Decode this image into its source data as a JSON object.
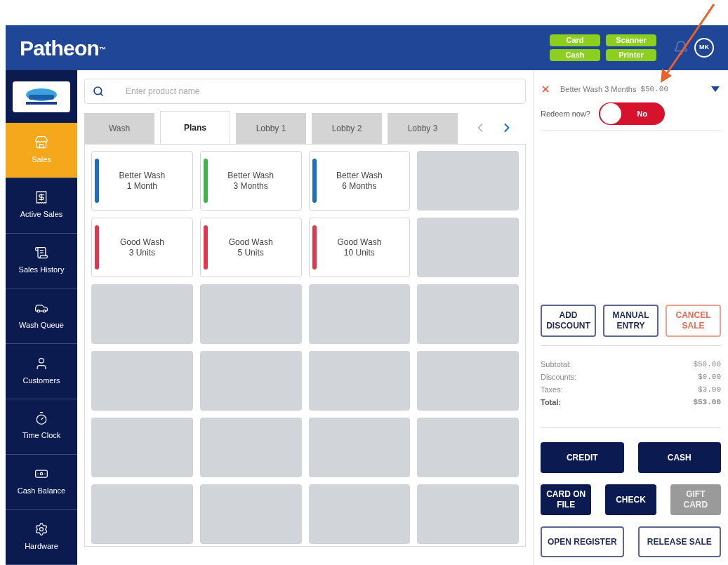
{
  "header": {
    "brand": "Patheon",
    "trademark": "™",
    "status_buttons": [
      "Card",
      "Scanner",
      "Cash",
      "Printer"
    ],
    "avatar": "MK"
  },
  "sidebar": {
    "items": [
      {
        "label": "Sales",
        "selected": true
      },
      {
        "label": "Active Sales",
        "selected": false
      },
      {
        "label": "Sales History",
        "selected": false
      },
      {
        "label": "Wash Queue",
        "selected": false
      },
      {
        "label": "Customers",
        "selected": false
      },
      {
        "label": "Time Clock",
        "selected": false
      },
      {
        "label": "Cash Balance",
        "selected": false
      },
      {
        "label": "Hardware",
        "selected": false
      }
    ]
  },
  "search": {
    "placeholder": "Enter product name"
  },
  "tabs": [
    {
      "label": "Wash",
      "selected": false
    },
    {
      "label": "Plans",
      "selected": true
    },
    {
      "label": "Lobby 1",
      "selected": false
    },
    {
      "label": "Lobby 2",
      "selected": false
    },
    {
      "label": "Lobby 3",
      "selected": false
    }
  ],
  "tiles": [
    {
      "kind": "product",
      "title": "Better Wash",
      "subtitle": "1 Month",
      "color": "#1a6fc0"
    },
    {
      "kind": "product",
      "title": "Better Wash",
      "subtitle": "3 Months",
      "color": "#3db54a"
    },
    {
      "kind": "product",
      "title": "Better Wash",
      "subtitle": "6 Months",
      "color": "#1a6fc0"
    },
    {
      "kind": "empty"
    },
    {
      "kind": "product",
      "title": "Good Wash",
      "subtitle": "3 Units",
      "color": "#e0384f"
    },
    {
      "kind": "product",
      "title": "Good Wash",
      "subtitle": "5 Units",
      "color": "#e0384f"
    },
    {
      "kind": "product",
      "title": "Good Wash",
      "subtitle": "10 Units",
      "color": "#e0384f"
    },
    {
      "kind": "empty"
    },
    {
      "kind": "empty"
    },
    {
      "kind": "empty"
    },
    {
      "kind": "empty"
    },
    {
      "kind": "empty"
    },
    {
      "kind": "empty"
    },
    {
      "kind": "empty"
    },
    {
      "kind": "empty"
    },
    {
      "kind": "empty"
    },
    {
      "kind": "empty"
    },
    {
      "kind": "empty"
    },
    {
      "kind": "empty"
    },
    {
      "kind": "empty"
    },
    {
      "kind": "empty"
    },
    {
      "kind": "empty"
    },
    {
      "kind": "empty"
    },
    {
      "kind": "empty"
    }
  ],
  "cart": {
    "item": {
      "name": "Better Wash 3 Months",
      "price": "$50.00"
    },
    "redeem": {
      "label": "Redeem now?",
      "on": false,
      "state_label": "No"
    }
  },
  "actions": [
    {
      "label": "ADD DISCOUNT",
      "kind": "outline"
    },
    {
      "label": "MANUAL ENTRY",
      "kind": "outline"
    },
    {
      "label": "CANCEL SALE",
      "kind": "danger"
    }
  ],
  "totals": [
    {
      "label": "Subtotal:",
      "value": "$50.00",
      "bold": false
    },
    {
      "label": "Discounts:",
      "value": "$0.00",
      "bold": false
    },
    {
      "label": "Taxes:",
      "value": "$3.00",
      "bold": false
    },
    {
      "label": "Total:",
      "value": "$53.00",
      "bold": true
    }
  ],
  "payment_rows": [
    [
      {
        "label": "CREDIT",
        "kind": "primary",
        "disabled": false
      },
      {
        "label": "CASH",
        "kind": "primary",
        "disabled": false
      }
    ],
    [
      {
        "label": "CARD ON FILE",
        "kind": "primary",
        "disabled": false
      },
      {
        "label": "CHECK",
        "kind": "primary",
        "disabled": false
      },
      {
        "label": "GIFT CARD",
        "kind": "primary",
        "disabled": true
      }
    ],
    [
      {
        "label": "OPEN REGISTER",
        "kind": "outline",
        "disabled": false
      },
      {
        "label": "RELEASE SALE",
        "kind": "outline",
        "disabled": false
      }
    ]
  ]
}
